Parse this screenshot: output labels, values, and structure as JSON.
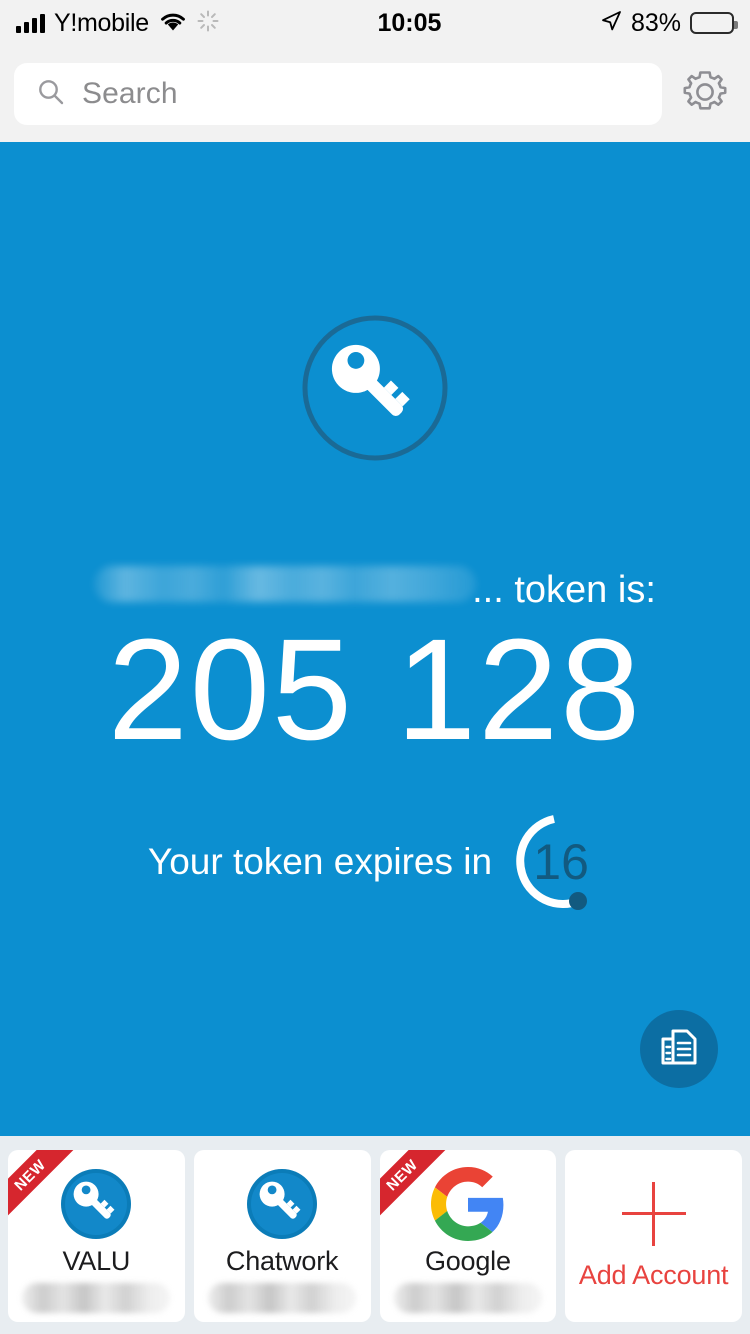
{
  "status_bar": {
    "carrier": "Y!mobile",
    "time": "10:05",
    "battery_percent": "83%",
    "wifi_icon": "wifi-icon",
    "activity_icon": "activity-spinner-icon",
    "location_icon": "location-arrow-icon",
    "signal_icon": "cellular-signal-icon",
    "battery_icon": "battery-icon"
  },
  "header": {
    "search_placeholder": "Search",
    "search_value": "",
    "search_icon": "search-icon",
    "settings_icon": "gear-icon"
  },
  "main": {
    "brand_icon": "key-icon",
    "account_name_redacted": "",
    "token_label_suffix": "... token is:",
    "token_code": "205 128",
    "expiry_label": "Your token expires in",
    "countdown_seconds": "16",
    "copy_button_icon": "copy-documents-icon",
    "background_color": "#0c8fd0",
    "accent_dark": "#125a80"
  },
  "accounts": {
    "badge_new_label": "NEW",
    "items": [
      {
        "name": "VALU",
        "icon": "key-icon",
        "is_new": true,
        "subtitle_redacted": ""
      },
      {
        "name": "Chatwork",
        "icon": "key-icon",
        "is_new": false,
        "subtitle_redacted": ""
      },
      {
        "name": "Google",
        "icon": "google-logo-icon",
        "is_new": true,
        "subtitle_redacted": ""
      }
    ],
    "add_account": {
      "label": "Add Account",
      "icon": "plus-icon",
      "color": "#e8433f"
    }
  }
}
